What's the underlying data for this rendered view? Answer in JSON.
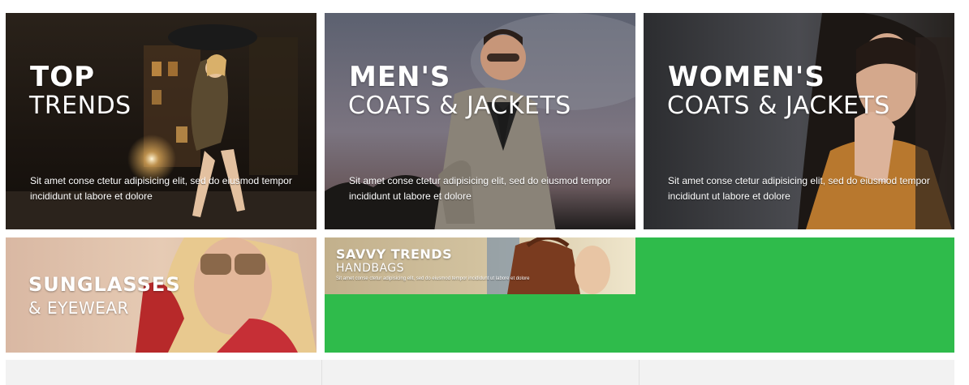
{
  "banners": [
    {
      "title": "TOP",
      "subtitle": "TRENDS",
      "description": "Sit amet conse ctetur adipisicing elit, sed do eiusmod tempor incididunt ut labore et dolore"
    },
    {
      "title": "MEN'S",
      "subtitle": "COATS & JACKETS",
      "description": "Sit amet conse ctetur adipisicing elit, sed do eiusmod tempor incididunt ut labore et dolore"
    },
    {
      "title": "WOMEN'S",
      "subtitle": "COATS & JACKETS",
      "description": "Sit amet conse ctetur adipisicing elit, sed do eiusmod tempor incididunt ut labore et dolore"
    },
    {
      "title": "SUNGLASSES",
      "subtitle": "& EYEWEAR"
    },
    {
      "title": "SAVVY TRENDS",
      "subtitle": "HANDBAGS",
      "description": "Sit amet conse ctetur adipisicing elit, sed do eiusmod tempor incididunt ut labore et dolore"
    }
  ],
  "colors": {
    "accent_green": "#2fbb4b",
    "footer_bg": "#f2f2f2"
  }
}
